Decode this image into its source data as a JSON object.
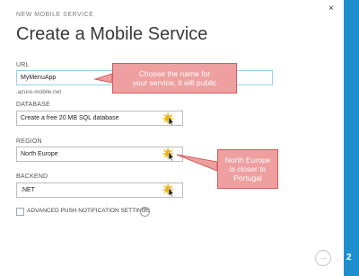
{
  "dialog": {
    "header_small": "NEW MOBILE SERVICE",
    "title": "Create a Mobile Service",
    "close_icon": "×"
  },
  "url": {
    "label": "URL",
    "value": "MyMenuApp",
    "suffix": ".azure-mobile.net"
  },
  "database": {
    "label": "DATABASE",
    "value": "Create a free 20 MB SQL database"
  },
  "region": {
    "label": "REGION",
    "value": "North Europe"
  },
  "backend": {
    "label": "BACKEND",
    "value": ".NET"
  },
  "advanced": {
    "label": "ADVANCED PUSH NOTIFICATION SETTINGS",
    "help_icon": "?"
  },
  "callouts": {
    "name_line1": "Choose the name for",
    "name_line2": "your service, it will public",
    "region_line1": "North Europe",
    "region_line2": "is closer to",
    "region_line3": "Portugal"
  },
  "footer": {
    "next_arrow": "→",
    "step": "2"
  },
  "colors": {
    "accent": "#1f8ecf",
    "callout_fill": "#ef9f9f",
    "callout_border": "#d45b5b",
    "spark": "#f0b000"
  },
  "icons": {
    "sparkle": "spark-cursor-icon",
    "close": "close-icon",
    "help": "help-icon",
    "next": "arrow-right-icon"
  }
}
